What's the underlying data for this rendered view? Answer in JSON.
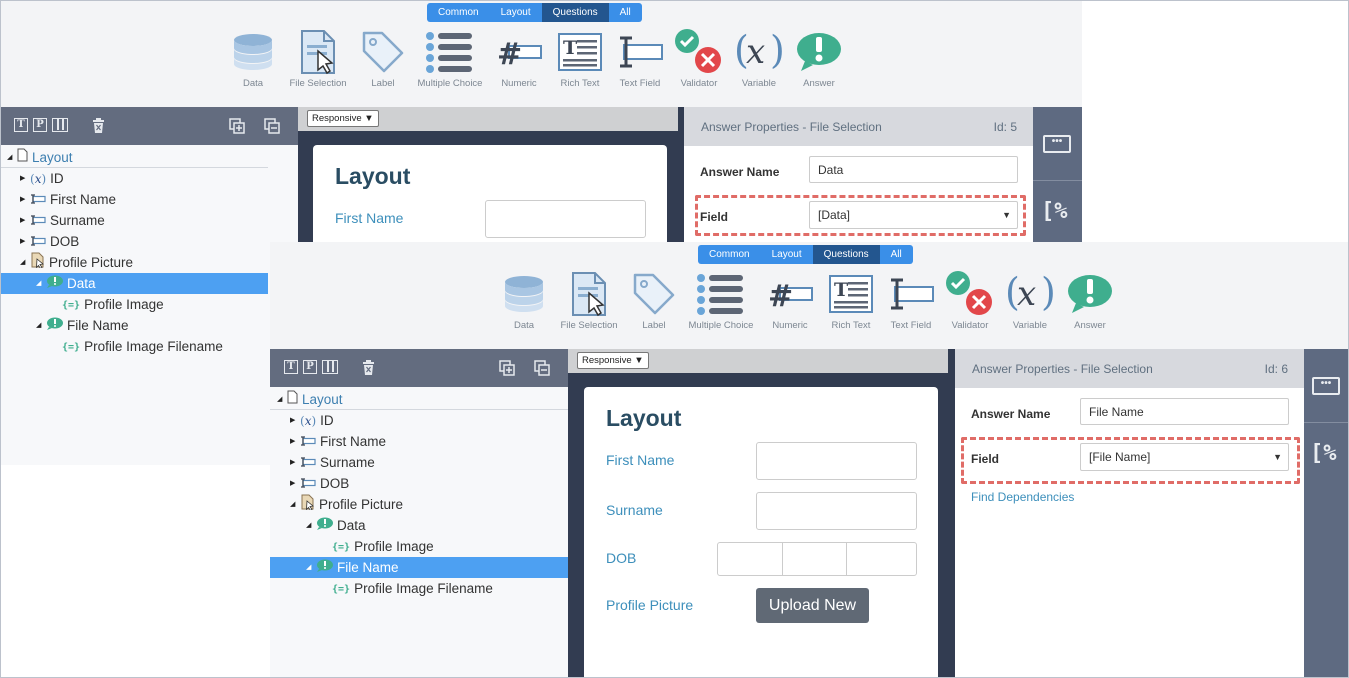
{
  "tabs": [
    "Common",
    "Layout",
    "Questions",
    "All"
  ],
  "active_tab_index": 2,
  "tools": [
    {
      "label": "Data",
      "icon": "data-icon"
    },
    {
      "label": "File Selection",
      "icon": "file-selection-icon"
    },
    {
      "label": "Label",
      "icon": "label-icon"
    },
    {
      "label": "Multiple Choice",
      "icon": "multiple-choice-icon"
    },
    {
      "label": "Numeric",
      "icon": "numeric-icon"
    },
    {
      "label": "Rich Text",
      "icon": "rich-text-icon"
    },
    {
      "label": "Text Field",
      "icon": "text-field-icon"
    },
    {
      "label": "Validator",
      "icon": "validator-icon"
    },
    {
      "label": "Variable",
      "icon": "variable-icon"
    },
    {
      "label": "Answer",
      "icon": "answer-icon"
    }
  ],
  "tree_toolbar": {
    "left_icons": [
      "text-mode-icon",
      "preview-icon",
      "columns-icon",
      "delete-icon"
    ],
    "right_icons": [
      "add-icon",
      "remove-icon"
    ]
  },
  "front": {
    "tree": [
      {
        "label": "Layout",
        "icon": "page-icon",
        "level": 0,
        "twisty": "open"
      },
      {
        "label": "ID",
        "icon": "variable-icon",
        "level": 1,
        "twisty": "closed"
      },
      {
        "label": "First Name",
        "icon": "textfield-icon",
        "level": 1,
        "twisty": "closed"
      },
      {
        "label": "Surname",
        "icon": "textfield-icon",
        "level": 1,
        "twisty": "closed"
      },
      {
        "label": "DOB",
        "icon": "textfield-icon",
        "level": 1,
        "twisty": "closed"
      },
      {
        "label": "Profile Picture",
        "icon": "file-icon",
        "level": 1,
        "twisty": "open"
      },
      {
        "label": "Data",
        "icon": "answer-icon",
        "level": 2,
        "twisty": "open"
      },
      {
        "label": "Profile Image",
        "icon": "field-icon",
        "level": 3,
        "twisty": "none"
      },
      {
        "label": "File Name",
        "icon": "answer-icon",
        "level": 2,
        "twisty": "open",
        "selected": true
      },
      {
        "label": "Profile Image Filename",
        "icon": "field-icon",
        "level": 3,
        "twisty": "none"
      }
    ],
    "responsive_label": "Responsive ▼",
    "form": {
      "title": "Layout",
      "fields": [
        "First Name",
        "Surname",
        "DOB",
        "Profile Picture"
      ],
      "upload_button": "Upload New"
    },
    "props": {
      "title": "Answer Properties - File Selection",
      "id": "Id: 6",
      "answer_name_label": "Answer Name",
      "answer_name_value": "File Name",
      "field_label": "Field",
      "field_value": "[File Name]",
      "find_dependencies": "Find Dependencies"
    }
  },
  "back": {
    "tree": [
      {
        "label": "Layout",
        "icon": "page-icon",
        "level": 0,
        "twisty": "open"
      },
      {
        "label": "ID",
        "icon": "variable-icon",
        "level": 1,
        "twisty": "closed"
      },
      {
        "label": "First Name",
        "icon": "textfield-icon",
        "level": 1,
        "twisty": "closed"
      },
      {
        "label": "Surname",
        "icon": "textfield-icon",
        "level": 1,
        "twisty": "closed"
      },
      {
        "label": "DOB",
        "icon": "textfield-icon",
        "level": 1,
        "twisty": "closed"
      },
      {
        "label": "Profile Picture",
        "icon": "file-icon",
        "level": 1,
        "twisty": "open"
      },
      {
        "label": "Data",
        "icon": "answer-icon",
        "level": 2,
        "twisty": "open",
        "selected": true
      },
      {
        "label": "Profile Image",
        "icon": "field-icon",
        "level": 3,
        "twisty": "none"
      },
      {
        "label": "File Name",
        "icon": "answer-icon",
        "level": 2,
        "twisty": "open"
      },
      {
        "label": "Profile Image Filename",
        "icon": "field-icon",
        "level": 3,
        "twisty": "none"
      }
    ],
    "responsive_label": "Responsive ▼",
    "form": {
      "title": "Layout",
      "fields": [
        "First Name"
      ]
    },
    "props": {
      "title": "Answer Properties - File Selection",
      "id": "Id: 5",
      "answer_name_label": "Answer Name",
      "answer_name_value": "Data",
      "field_label": "Field",
      "field_value": "[Data]"
    }
  },
  "sidebar_icons": [
    "ellipsis-box-icon",
    "code-percent-icon"
  ],
  "colors": {
    "tab_active": "#23568f",
    "tab": "#3a8fe8",
    "selected_row": "#4da0f2",
    "highlight_dash": "#e06c67",
    "label_blue": "#3d8fbb"
  }
}
